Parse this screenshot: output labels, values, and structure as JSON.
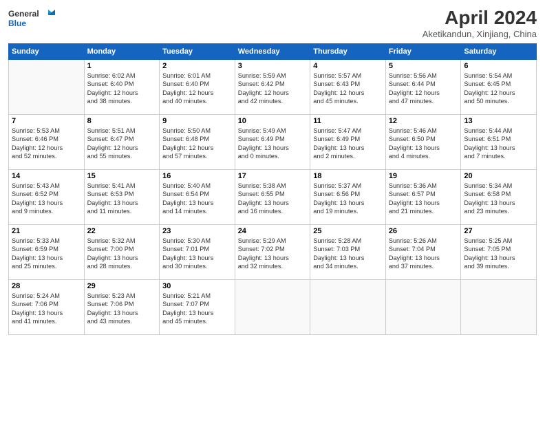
{
  "header": {
    "logo_general": "General",
    "logo_blue": "Blue",
    "title": "April 2024",
    "subtitle": "Aketikandun, Xinjiang, China"
  },
  "days_of_week": [
    "Sunday",
    "Monday",
    "Tuesday",
    "Wednesday",
    "Thursday",
    "Friday",
    "Saturday"
  ],
  "weeks": [
    [
      {
        "day": "",
        "content": ""
      },
      {
        "day": "1",
        "content": "Sunrise: 6:02 AM\nSunset: 6:40 PM\nDaylight: 12 hours\nand 38 minutes."
      },
      {
        "day": "2",
        "content": "Sunrise: 6:01 AM\nSunset: 6:40 PM\nDaylight: 12 hours\nand 40 minutes."
      },
      {
        "day": "3",
        "content": "Sunrise: 5:59 AM\nSunset: 6:42 PM\nDaylight: 12 hours\nand 42 minutes."
      },
      {
        "day": "4",
        "content": "Sunrise: 5:57 AM\nSunset: 6:43 PM\nDaylight: 12 hours\nand 45 minutes."
      },
      {
        "day": "5",
        "content": "Sunrise: 5:56 AM\nSunset: 6:44 PM\nDaylight: 12 hours\nand 47 minutes."
      },
      {
        "day": "6",
        "content": "Sunrise: 5:54 AM\nSunset: 6:45 PM\nDaylight: 12 hours\nand 50 minutes."
      }
    ],
    [
      {
        "day": "7",
        "content": "Sunrise: 5:53 AM\nSunset: 6:46 PM\nDaylight: 12 hours\nand 52 minutes."
      },
      {
        "day": "8",
        "content": "Sunrise: 5:51 AM\nSunset: 6:47 PM\nDaylight: 12 hours\nand 55 minutes."
      },
      {
        "day": "9",
        "content": "Sunrise: 5:50 AM\nSunset: 6:48 PM\nDaylight: 12 hours\nand 57 minutes."
      },
      {
        "day": "10",
        "content": "Sunrise: 5:49 AM\nSunset: 6:49 PM\nDaylight: 13 hours\nand 0 minutes."
      },
      {
        "day": "11",
        "content": "Sunrise: 5:47 AM\nSunset: 6:49 PM\nDaylight: 13 hours\nand 2 minutes."
      },
      {
        "day": "12",
        "content": "Sunrise: 5:46 AM\nSunset: 6:50 PM\nDaylight: 13 hours\nand 4 minutes."
      },
      {
        "day": "13",
        "content": "Sunrise: 5:44 AM\nSunset: 6:51 PM\nDaylight: 13 hours\nand 7 minutes."
      }
    ],
    [
      {
        "day": "14",
        "content": "Sunrise: 5:43 AM\nSunset: 6:52 PM\nDaylight: 13 hours\nand 9 minutes."
      },
      {
        "day": "15",
        "content": "Sunrise: 5:41 AM\nSunset: 6:53 PM\nDaylight: 13 hours\nand 11 minutes."
      },
      {
        "day": "16",
        "content": "Sunrise: 5:40 AM\nSunset: 6:54 PM\nDaylight: 13 hours\nand 14 minutes."
      },
      {
        "day": "17",
        "content": "Sunrise: 5:38 AM\nSunset: 6:55 PM\nDaylight: 13 hours\nand 16 minutes."
      },
      {
        "day": "18",
        "content": "Sunrise: 5:37 AM\nSunset: 6:56 PM\nDaylight: 13 hours\nand 19 minutes."
      },
      {
        "day": "19",
        "content": "Sunrise: 5:36 AM\nSunset: 6:57 PM\nDaylight: 13 hours\nand 21 minutes."
      },
      {
        "day": "20",
        "content": "Sunrise: 5:34 AM\nSunset: 6:58 PM\nDaylight: 13 hours\nand 23 minutes."
      }
    ],
    [
      {
        "day": "21",
        "content": "Sunrise: 5:33 AM\nSunset: 6:59 PM\nDaylight: 13 hours\nand 25 minutes."
      },
      {
        "day": "22",
        "content": "Sunrise: 5:32 AM\nSunset: 7:00 PM\nDaylight: 13 hours\nand 28 minutes."
      },
      {
        "day": "23",
        "content": "Sunrise: 5:30 AM\nSunset: 7:01 PM\nDaylight: 13 hours\nand 30 minutes."
      },
      {
        "day": "24",
        "content": "Sunrise: 5:29 AM\nSunset: 7:02 PM\nDaylight: 13 hours\nand 32 minutes."
      },
      {
        "day": "25",
        "content": "Sunrise: 5:28 AM\nSunset: 7:03 PM\nDaylight: 13 hours\nand 34 minutes."
      },
      {
        "day": "26",
        "content": "Sunrise: 5:26 AM\nSunset: 7:04 PM\nDaylight: 13 hours\nand 37 minutes."
      },
      {
        "day": "27",
        "content": "Sunrise: 5:25 AM\nSunset: 7:05 PM\nDaylight: 13 hours\nand 39 minutes."
      }
    ],
    [
      {
        "day": "28",
        "content": "Sunrise: 5:24 AM\nSunset: 7:06 PM\nDaylight: 13 hours\nand 41 minutes."
      },
      {
        "day": "29",
        "content": "Sunrise: 5:23 AM\nSunset: 7:06 PM\nDaylight: 13 hours\nand 43 minutes."
      },
      {
        "day": "30",
        "content": "Sunrise: 5:21 AM\nSunset: 7:07 PM\nDaylight: 13 hours\nand 45 minutes."
      },
      {
        "day": "",
        "content": ""
      },
      {
        "day": "",
        "content": ""
      },
      {
        "day": "",
        "content": ""
      },
      {
        "day": "",
        "content": ""
      }
    ]
  ]
}
